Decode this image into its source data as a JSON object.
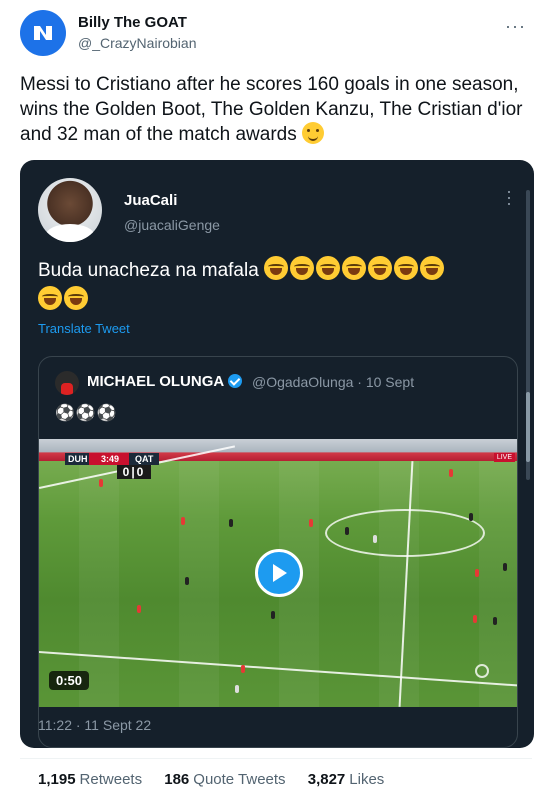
{
  "outer_tweet": {
    "author_name": "Billy The GOAT",
    "author_handle": "@_CrazyNairobian",
    "more_label": "···",
    "text": "Messi to Cristiano after he scores 160 goals in one season, wins the Golden Boot, The Golden Kanzu, The Cristian d'ior and 32 man of the match awards",
    "emoji_icon": "drooling-face-icon"
  },
  "inner_tweet": {
    "author_name": "JuaCali",
    "author_handle": "@juacaliGenge",
    "text": "Buda unacheza na mafala",
    "emoji_icon": "rolling-laughing-face-icon",
    "translate_label": "Translate Tweet",
    "timestamp": "11:22 · 11 Sept 22"
  },
  "quoted_tweet": {
    "author_name": "MICHAEL OLUNGA",
    "author_handle": "@OgadaOlunga",
    "date": "· 10 Sept",
    "text": "⚽⚽⚽",
    "video": {
      "duration": "0:50",
      "scoreboard_home": "DUH",
      "scoreboard_clock": "3:49",
      "scoreboard_away": "QAT",
      "scoreboard_score": "0|0",
      "live_label": "LIVE"
    }
  },
  "stats": {
    "retweets_count": "1,195",
    "retweets_label": "Retweets",
    "quotes_count": "186",
    "quotes_label": "Quote Tweets",
    "likes_count": "3,827",
    "likes_label": "Likes"
  },
  "colors": {
    "accent": "#1d9bf0",
    "dark_bg": "#15202b",
    "pitch": "#5a9537"
  }
}
